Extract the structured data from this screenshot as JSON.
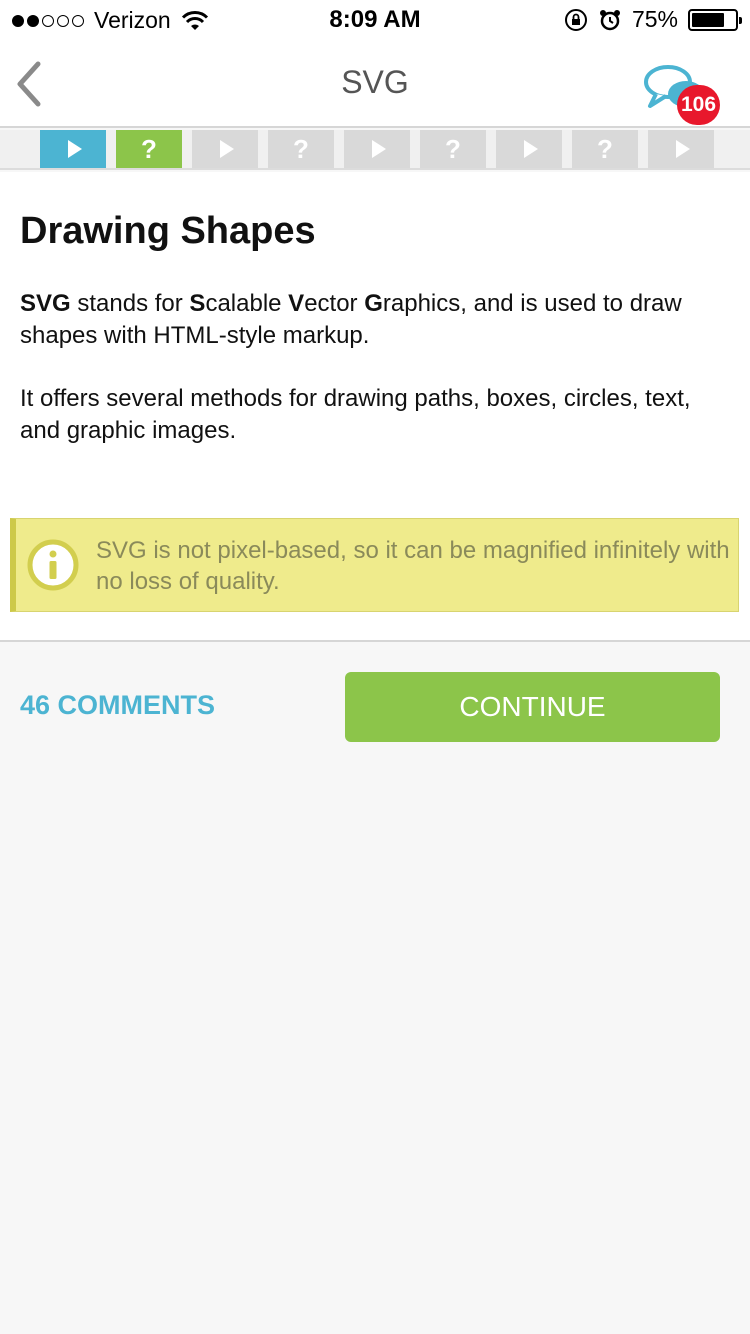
{
  "status_bar": {
    "carrier": "Verizon",
    "time": "8:09 AM",
    "battery": "75%",
    "battery_level": 0.75,
    "signal_bars": 2,
    "signal_total": 5
  },
  "nav": {
    "title": "SVG",
    "badge_count": "106"
  },
  "steps": [
    {
      "type": "play",
      "state": "active"
    },
    {
      "type": "quiz",
      "state": "done",
      "label": "?"
    },
    {
      "type": "play",
      "state": "pending"
    },
    {
      "type": "quiz",
      "state": "pending",
      "label": "?"
    },
    {
      "type": "play",
      "state": "pending"
    },
    {
      "type": "quiz",
      "state": "pending",
      "label": "?"
    },
    {
      "type": "play",
      "state": "pending"
    },
    {
      "type": "quiz",
      "state": "pending",
      "label": "?"
    },
    {
      "type": "play",
      "state": "pending"
    }
  ],
  "lesson": {
    "title": "Drawing Shapes",
    "para1": {
      "b1": "SVG",
      "t1": " stands for ",
      "b2": "S",
      "t2": "calable ",
      "b3": "V",
      "t3": "ector ",
      "b4": "G",
      "t4": "raphics, and is used to draw shapes with HTML-style markup."
    },
    "para2": "It offers several methods for drawing paths, boxes, circles, text, and graphic images.",
    "note": "SVG is not pixel-based, so it can be magnified infinitely with no loss of quality."
  },
  "footer": {
    "comments_label": "46 COMMENTS",
    "continue_label": "CONTINUE"
  },
  "colors": {
    "accent_blue": "#4cb4d2",
    "accent_green": "#8cc54a",
    "badge_red": "#e8182c",
    "note_yellow": "#efeb8c"
  }
}
